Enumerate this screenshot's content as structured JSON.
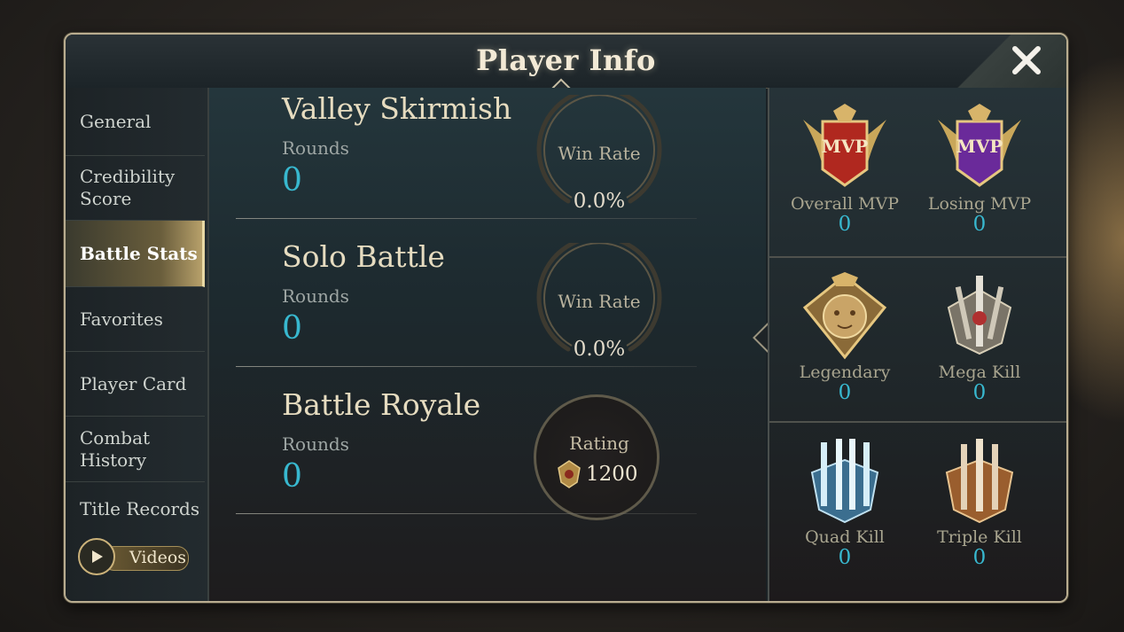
{
  "header": {
    "title": "Player Info",
    "close_icon": "close-x-icon"
  },
  "sidebar": {
    "items": [
      {
        "label": "General"
      },
      {
        "label": "Credibility Score"
      },
      {
        "label": "Battle Stats",
        "active": true
      },
      {
        "label": "Favorites"
      },
      {
        "label": "Player Card"
      },
      {
        "label": "Combat History"
      },
      {
        "label": "Title Records"
      }
    ],
    "videos_label": "Videos"
  },
  "modes": [
    {
      "title": "Valley Skirmish",
      "rounds_label": "Rounds",
      "rounds": "0",
      "gauge_label": "Win Rate",
      "win_rate": "0.0%"
    },
    {
      "title": "Solo Battle",
      "rounds_label": "Rounds",
      "rounds": "0",
      "gauge_label": "Win Rate",
      "win_rate": "0.0%"
    },
    {
      "title": "Battle Royale",
      "rounds_label": "Rounds",
      "rounds": "0",
      "rating_label": "Rating",
      "rating": "1200"
    }
  ],
  "achievements": [
    {
      "name": "Overall MVP",
      "value": "0",
      "icon": "mvp-red-badge-icon"
    },
    {
      "name": "Losing MVP",
      "value": "0",
      "icon": "mvp-purple-badge-icon"
    },
    {
      "name": "Legendary",
      "value": "0",
      "icon": "lion-crest-icon"
    },
    {
      "name": "Mega Kill",
      "value": "0",
      "icon": "swords-crest-icon"
    },
    {
      "name": "Quad Kill",
      "value": "0",
      "icon": "blue-swords-icon"
    },
    {
      "name": "Triple Kill",
      "value": "0",
      "icon": "bronze-swords-icon"
    }
  ],
  "badge_text": {
    "mvp": "MVP"
  },
  "colors": {
    "accent_value": "#38b8cf",
    "gold": "#c9a75a",
    "text_title": "#e6dcc0"
  }
}
